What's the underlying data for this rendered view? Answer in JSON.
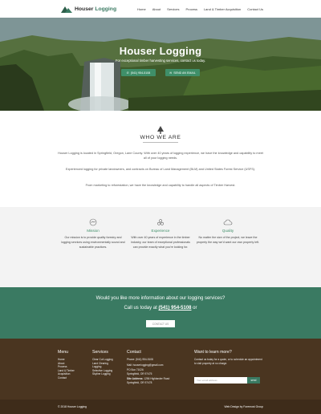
{
  "nav": {
    "logo_word1": "Houser ",
    "logo_word2": "Logging",
    "items": [
      "Home",
      "About",
      "Services",
      "Process",
      "Land & Timber Acquisition",
      "Contact Us"
    ]
  },
  "hero": {
    "title": "Houser Logging",
    "subtitle": "For exceptional timber harvesting services, contact us today.",
    "phone_button": "(541) 954-5108",
    "email_button": "SEND AN EMAIL"
  },
  "who": {
    "title": "WHO WE ARE",
    "p1": "Houser Logging is located in Springfield, Oregon, Lane County. With over 40 years of logging experience, we have the knowledge and capability to meet all of your logging needs.",
    "p2": "Experienced logging for private landowners, and contracts on Bureau of Land Management (BLM) and United States Forest Service (USFS).",
    "p3": "From marketing to reforestation, we have the knowledge and capability to handle all aspects of Timber Harvest."
  },
  "features": [
    {
      "title": "Mission",
      "icon": "handshake-icon",
      "text": "Our mission is to provide quality forestry and logging services using environmentally sound and sustainable practices."
    },
    {
      "title": "Experience",
      "icon": "team-icon",
      "text": "With over 40 years of experience in the timber industry, our team of exceptional professionals can provide exactly what you're looking for."
    },
    {
      "title": "Quality",
      "icon": "cloud-icon",
      "text": "No matter the size of the project, we leave the property the way we'd want our own property left."
    }
  ],
  "cta": {
    "line1": "Would you like more information about our logging services?",
    "line2_pre": "Call us today at ",
    "phone": "(541) 954-5108",
    "line2_post": " or",
    "button": "CONTACT US"
  },
  "footer": {
    "menu_title": "Menu",
    "menu_items": [
      "Home",
      "About",
      "Process",
      "Land & Timber",
      "Acquisition",
      "Contact"
    ],
    "services_title": "Services",
    "services_items": [
      "Clear Cut Logging",
      "Land Clearing",
      "Logging",
      "Selective Logging",
      "Skyline Logging"
    ],
    "contact_title": "Contact",
    "contact_phone": "Phone: (541) 954-5108",
    "contact_mail": "Mail: houserlogging@gmail.com",
    "contact_po1": "PO Box 71026",
    "contact_po2": "Springfield, OR 97475",
    "site_label": "Site Address: ",
    "site1": "1256 Highlander Road",
    "site2": "Springfield, OR 97478",
    "learn_title": "Want to learn more?",
    "learn_text": "Contact us today for a quote, or to schedule an appointment to visit property at no charge.",
    "email_placeholder": "Your email address",
    "send": "send"
  },
  "bottom": {
    "copyright": "© 2018 Houser Logging",
    "credit": "Web Design by Foremost Group"
  },
  "colors": {
    "accent": "#3a7a62",
    "footer": "#4a3520"
  }
}
